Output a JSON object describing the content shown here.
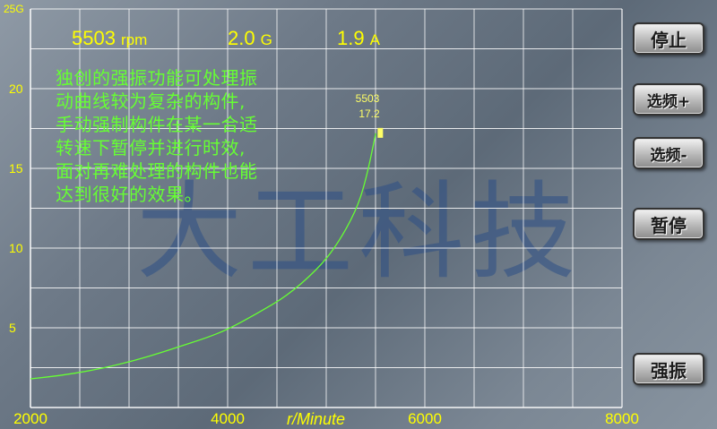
{
  "readouts": {
    "rpm_value": "5503",
    "rpm_unit": "rpm",
    "g_value": "2.0",
    "g_unit": "G",
    "current_value": "1.9",
    "current_unit": "A"
  },
  "description_lines": [
    "独创的强振功能可处理振",
    "动曲线较为复杂的构件,",
    "手动强制构件在某一合适",
    "转速下暂停并进行时效,",
    "面对再难处理的构件也能",
    "达到很好的效果。"
  ],
  "watermark": "大工科技",
  "buttons": {
    "stop": "停止",
    "select_up": "选频+",
    "select_down": "选频-",
    "pause": "暂停",
    "force_vibration": "强振"
  },
  "point_label": {
    "x": "5503",
    "y": "17.2"
  },
  "chart_data": {
    "type": "line",
    "xlabel": "r/Minute",
    "ylabel": "",
    "xlim": [
      2000,
      8000
    ],
    "ylim": [
      0,
      25
    ],
    "x_ticks": [
      "2000",
      "4000",
      "6000",
      "8000"
    ],
    "y_ticks": [
      "5",
      "10",
      "15",
      "20",
      "25G"
    ],
    "grid": true,
    "series": [
      {
        "color": "#66ff33",
        "x": [
          2000,
          2300,
          2600,
          2900,
          3200,
          3500,
          3800,
          4000,
          4300,
          4600,
          4900,
          5100,
          5300,
          5400,
          5503
        ],
        "y": [
          1.8,
          2.0,
          2.3,
          2.7,
          3.2,
          3.8,
          4.4,
          4.9,
          5.9,
          7.0,
          8.6,
          10.1,
          12.3,
          14.2,
          17.2
        ]
      }
    ],
    "marker": {
      "x": 5503,
      "y": 17.2,
      "color": "#ffff66"
    }
  },
  "colors": {
    "text_accent": "#ffff00",
    "curve": "#66ff33",
    "grid": "#ffffff"
  }
}
